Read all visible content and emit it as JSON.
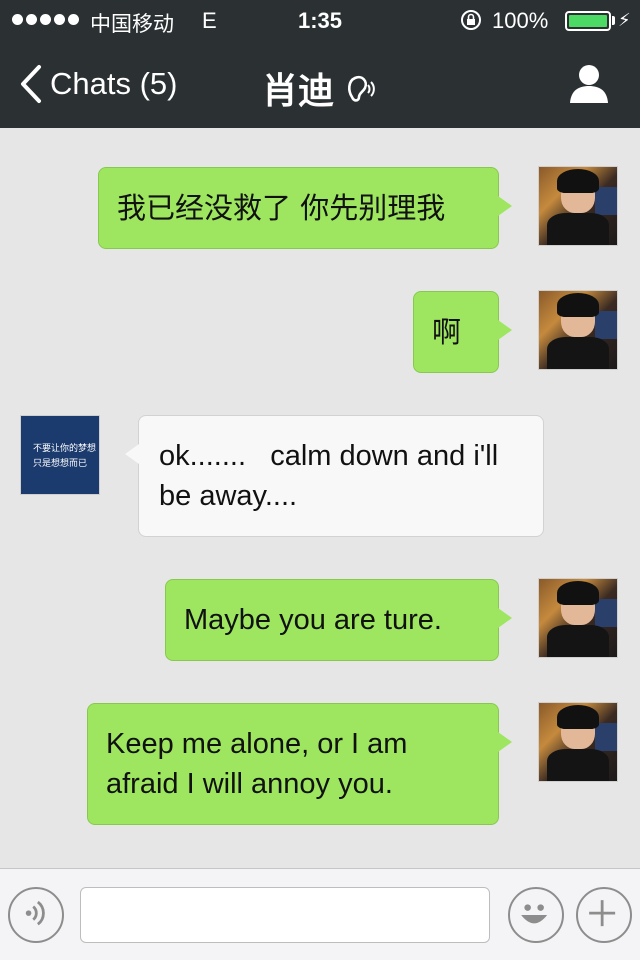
{
  "status_bar": {
    "carrier": "中国移动",
    "network": "E",
    "time": "1:35",
    "battery": "100%",
    "battery_level": 1.0
  },
  "nav": {
    "back_label": "Chats (5)",
    "title": "肖迪"
  },
  "messages": [
    {
      "side": "me",
      "text": "我已经没救了 你先别理我"
    },
    {
      "side": "me",
      "text": "啊"
    },
    {
      "side": "other",
      "text": "ok.......   calm down and i'll be away...."
    },
    {
      "side": "me",
      "text": "Maybe you are ture."
    },
    {
      "side": "me",
      "text": "Keep me alone, or I am afraid I will annoy you."
    }
  ],
  "other_avatar_text": {
    "line1": "不要让你的梦想",
    "line2": "只是想想而已"
  },
  "colors": {
    "nav_bg": "#2b3033",
    "bubble_me": "#9ee65f",
    "bubble_other": "#f8f8f8",
    "chat_bg": "#e6e6e6",
    "battery": "#4cd964"
  }
}
